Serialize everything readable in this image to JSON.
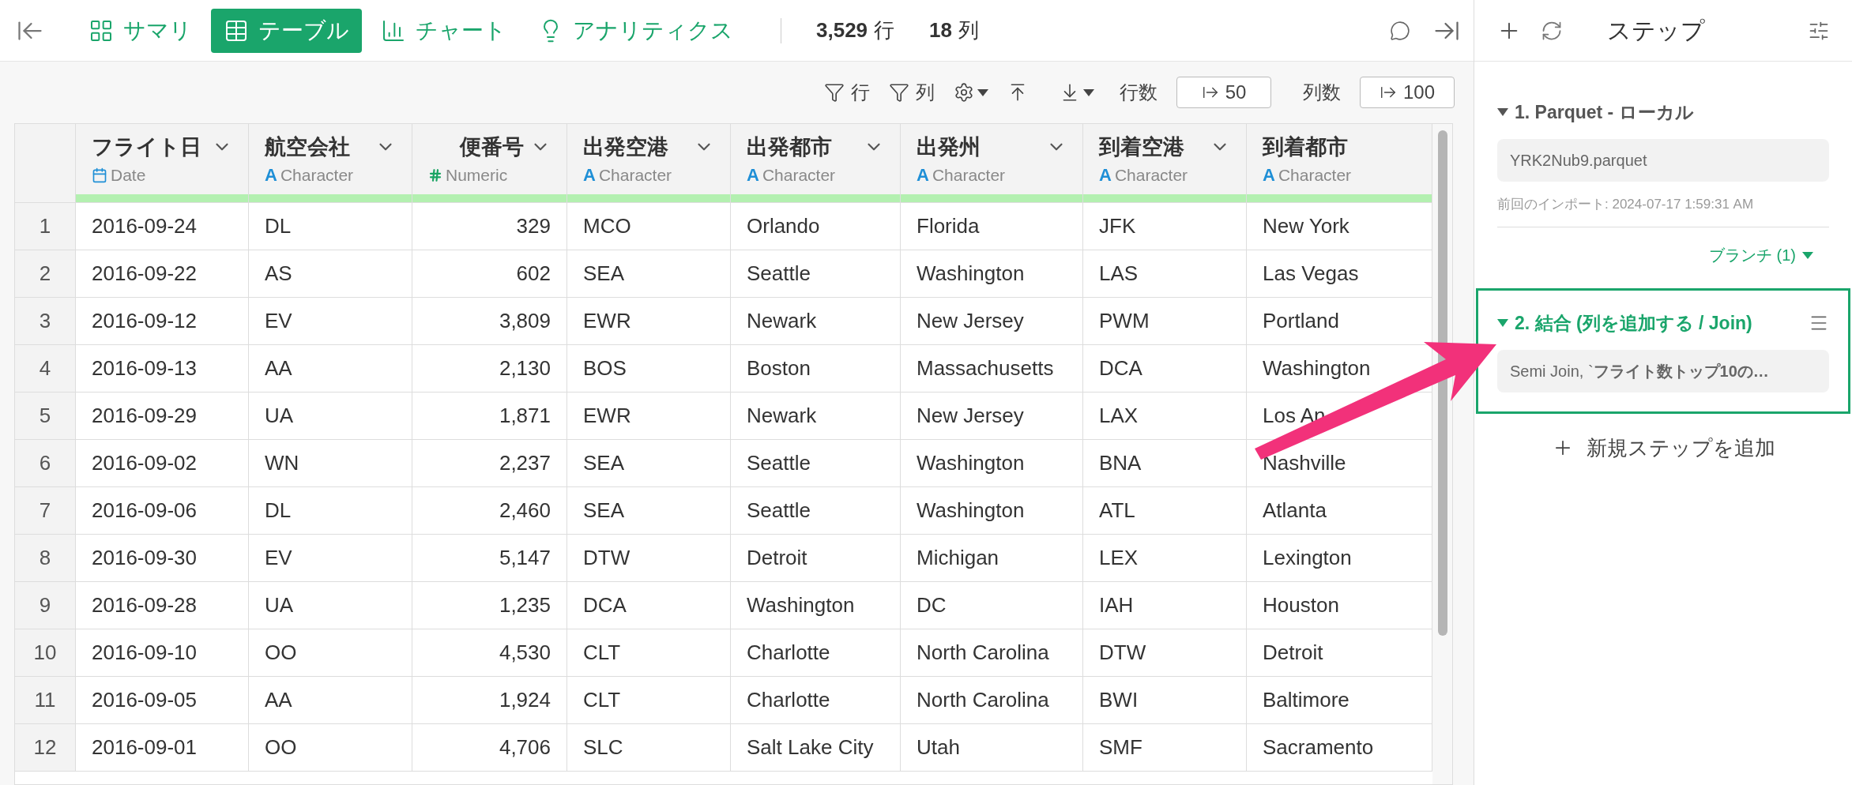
{
  "view_tabs": [
    {
      "label": "サマリ",
      "kind": "summary",
      "selected": false
    },
    {
      "label": "テーブル",
      "kind": "table",
      "selected": true
    },
    {
      "label": "チャート",
      "kind": "chart",
      "selected": false
    },
    {
      "label": "アナリティクス",
      "kind": "analytics",
      "selected": false
    }
  ],
  "stats": [
    {
      "value": "3,529",
      "unit": "行"
    },
    {
      "value": "18",
      "unit": "列"
    }
  ],
  "toolbar": {
    "row_filter": "行",
    "column_filter": "列",
    "rows_label": "行数",
    "rows_value": "50",
    "cols_label": "列数",
    "cols_value": "100"
  },
  "table": {
    "columns": [
      {
        "name": "フライト日",
        "type": "Date",
        "kind": "date",
        "menu": true
      },
      {
        "name": "航空会社",
        "type": "Character",
        "kind": "character",
        "icon": "A",
        "menu": true
      },
      {
        "name": "便番号",
        "type": "Numeric",
        "kind": "numeric",
        "menu": true
      },
      {
        "name": "出発空港",
        "type": "Character",
        "kind": "character",
        "icon": "A",
        "menu": true
      },
      {
        "name": "出発都市",
        "type": "Character",
        "kind": "character",
        "icon": "A",
        "menu": true
      },
      {
        "name": "出発州",
        "type": "Character",
        "kind": "character",
        "icon": "A",
        "menu": true
      },
      {
        "name": "到着空港",
        "type": "Character",
        "kind": "character",
        "icon": "A",
        "menu": true
      },
      {
        "name": "到着都市",
        "type": "Character",
        "kind": "character",
        "icon": "A",
        "menu": false
      }
    ],
    "rows": [
      {
        "index": "1",
        "cells": [
          "2016-09-24",
          "DL",
          "329",
          "MCO",
          "Orlando",
          "Florida",
          "JFK",
          "New York"
        ]
      },
      {
        "index": "2",
        "cells": [
          "2016-09-22",
          "AS",
          "602",
          "SEA",
          "Seattle",
          "Washington",
          "LAS",
          "Las Vegas"
        ]
      },
      {
        "index": "3",
        "cells": [
          "2016-09-12",
          "EV",
          "3,809",
          "EWR",
          "Newark",
          "New Jersey",
          "PWM",
          "Portland"
        ]
      },
      {
        "index": "4",
        "cells": [
          "2016-09-13",
          "AA",
          "2,130",
          "BOS",
          "Boston",
          "Massachusetts",
          "DCA",
          "Washington"
        ]
      },
      {
        "index": "5",
        "cells": [
          "2016-09-29",
          "UA",
          "1,871",
          "EWR",
          "Newark",
          "New Jersey",
          "LAX",
          "Los An"
        ]
      },
      {
        "index": "6",
        "cells": [
          "2016-09-02",
          "WN",
          "2,237",
          "SEA",
          "Seattle",
          "Washington",
          "BNA",
          "Nashville"
        ]
      },
      {
        "index": "7",
        "cells": [
          "2016-09-06",
          "DL",
          "2,460",
          "SEA",
          "Seattle",
          "Washington",
          "ATL",
          "Atlanta"
        ]
      },
      {
        "index": "8",
        "cells": [
          "2016-09-30",
          "EV",
          "5,147",
          "DTW",
          "Detroit",
          "Michigan",
          "LEX",
          "Lexington"
        ]
      },
      {
        "index": "9",
        "cells": [
          "2016-09-28",
          "UA",
          "1,235",
          "DCA",
          "Washington",
          "DC",
          "IAH",
          "Houston"
        ]
      },
      {
        "index": "10",
        "cells": [
          "2016-09-10",
          "OO",
          "4,530",
          "CLT",
          "Charlotte",
          "North Carolina",
          "DTW",
          "Detroit"
        ]
      },
      {
        "index": "11",
        "cells": [
          "2016-09-05",
          "AA",
          "1,924",
          "CLT",
          "Charlotte",
          "North Carolina",
          "BWI",
          "Baltimore"
        ]
      },
      {
        "index": "12",
        "cells": [
          "2016-09-01",
          "OO",
          "4,706",
          "SLC",
          "Salt Lake City",
          "Utah",
          "SMF",
          "Sacramento"
        ]
      }
    ]
  },
  "steps_panel": {
    "title": "ステップ",
    "steps": [
      {
        "title": "1. Parquet - ローカル",
        "expanded": true,
        "selected": false,
        "detail": "YRK2Nub9.parquet",
        "note": "前回のインポート: 2024-07-17 1:59:31 AM",
        "branch": "ブランチ (1)"
      },
      {
        "title": "2. 結合 (列を追加する / Join)",
        "expanded": true,
        "selected": true,
        "detail": "Semi Join, `**フライト数トップ10の…**"
      }
    ],
    "add_step": "新規ステップを追加"
  }
}
